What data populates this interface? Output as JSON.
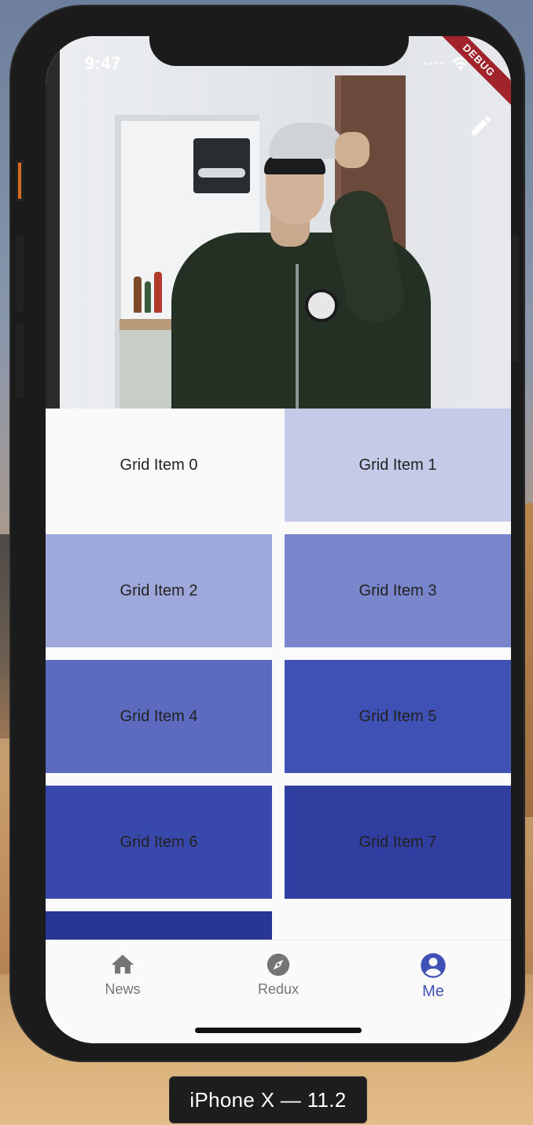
{
  "status_bar": {
    "time": "9:47",
    "debug_banner": "DEBUG"
  },
  "header": {
    "edit_icon": "pencil-icon"
  },
  "grid": {
    "items": [
      {
        "label": "Grid Item 0",
        "color": "#fafafa"
      },
      {
        "label": "Grid Item 1",
        "color": "#c5cae9"
      },
      {
        "label": "Grid Item 2",
        "color": "#9fa8da"
      },
      {
        "label": "Grid Item 3",
        "color": "#7986cb"
      },
      {
        "label": "Grid Item 4",
        "color": "#5c6bc0"
      },
      {
        "label": "Grid Item 5",
        "color": "#3f51b5"
      },
      {
        "label": "Grid Item 6",
        "color": "#3949ab"
      },
      {
        "label": "Grid Item 7",
        "color": "#303f9f"
      },
      {
        "label": "",
        "color": "#283593"
      }
    ]
  },
  "bottom_nav": {
    "items": [
      {
        "label": "News",
        "icon": "home-icon",
        "active": false
      },
      {
        "label": "Redux",
        "icon": "compass-icon",
        "active": false
      },
      {
        "label": "Me",
        "icon": "account-circle-icon",
        "active": true
      }
    ],
    "active_color": "#3f51b5",
    "inactive_color": "#757575"
  },
  "device": {
    "label": "iPhone X — 11.2"
  }
}
